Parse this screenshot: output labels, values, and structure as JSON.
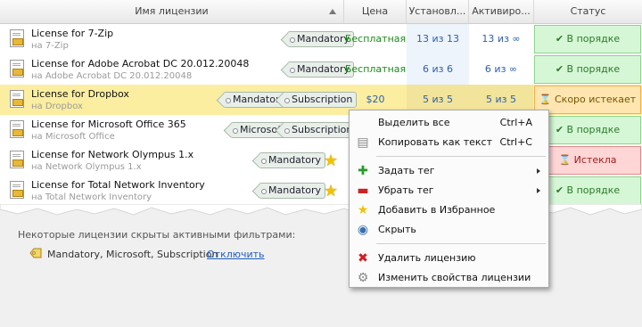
{
  "header": {
    "name_col": "Имя лицензии",
    "price_col": "Цена",
    "installed_col": "Установл...",
    "activated_col": "Активиро...",
    "status_col": "Статус"
  },
  "rows": [
    {
      "name": "License for 7-Zip",
      "sub": "на 7-Zip",
      "tags": [
        "Mandatory"
      ],
      "price": "Бесплатная",
      "installed": "13 из 13",
      "activated": "13 из ∞",
      "status": "✔ В порядке"
    },
    {
      "name": "License for Adobe Acrobat DC 20.012.20048",
      "sub": "на Adobe Acrobat DC 20.012.20048",
      "tags": [
        "Mandatory"
      ],
      "price": "Бесплатная",
      "installed": "6 из 6",
      "activated": "6 из ∞",
      "status": "✔ В порядке"
    },
    {
      "name": "License for Dropbox",
      "sub": "на Dropbox",
      "tags": [
        "Mandatory",
        "Subscription"
      ],
      "price": "$20",
      "installed": "5 из 5",
      "activated": "5 из 5",
      "status": "⌛ Скоро истекает"
    },
    {
      "name": "License for Microsoft Office 365",
      "sub": "на Microsoft Office",
      "tags": [
        "Microsoft",
        "Subscription"
      ],
      "price": "",
      "installed": "",
      "activated": "",
      "status": "✔ В порядке"
    },
    {
      "name": "License for Network Olympus 1.x",
      "sub": "на Network Olympus 1.x",
      "tags": [
        "Mandatory"
      ],
      "price": "",
      "installed": "",
      "activated": "",
      "status": "⌛ Истекла"
    },
    {
      "name": "License for Total Network Inventory",
      "sub": "на Total Network Inventory",
      "tags": [
        "Mandatory"
      ],
      "price": "",
      "installed": "",
      "activated": "",
      "status": "✔ В порядке"
    }
  ],
  "footer": {
    "note": "Некоторые лицензии скрыты активными фильтрами:",
    "filters": "Mandatory, Microsoft, Subscription",
    "disable_link": "Отключить"
  },
  "context_menu": {
    "select_all": "Выделить все",
    "select_all_shortcut": "Ctrl+A",
    "copy_text": "Копировать как текст",
    "copy_text_shortcut": "Ctrl+C",
    "set_tag": "Задать тег",
    "remove_tag": "Убрать тег",
    "add_favorite": "Добавить в Избранное",
    "hide": "Скрыть",
    "delete": "Удалить лицензию",
    "properties": "Изменить свойства лицензии"
  },
  "colors": {
    "ok_green": "#d6f7d6",
    "warn_orange": "#ffe6b0",
    "bad_red": "#ffd6d6",
    "selected_row": "#fbeea0",
    "link_blue": "#1f5fbf"
  }
}
